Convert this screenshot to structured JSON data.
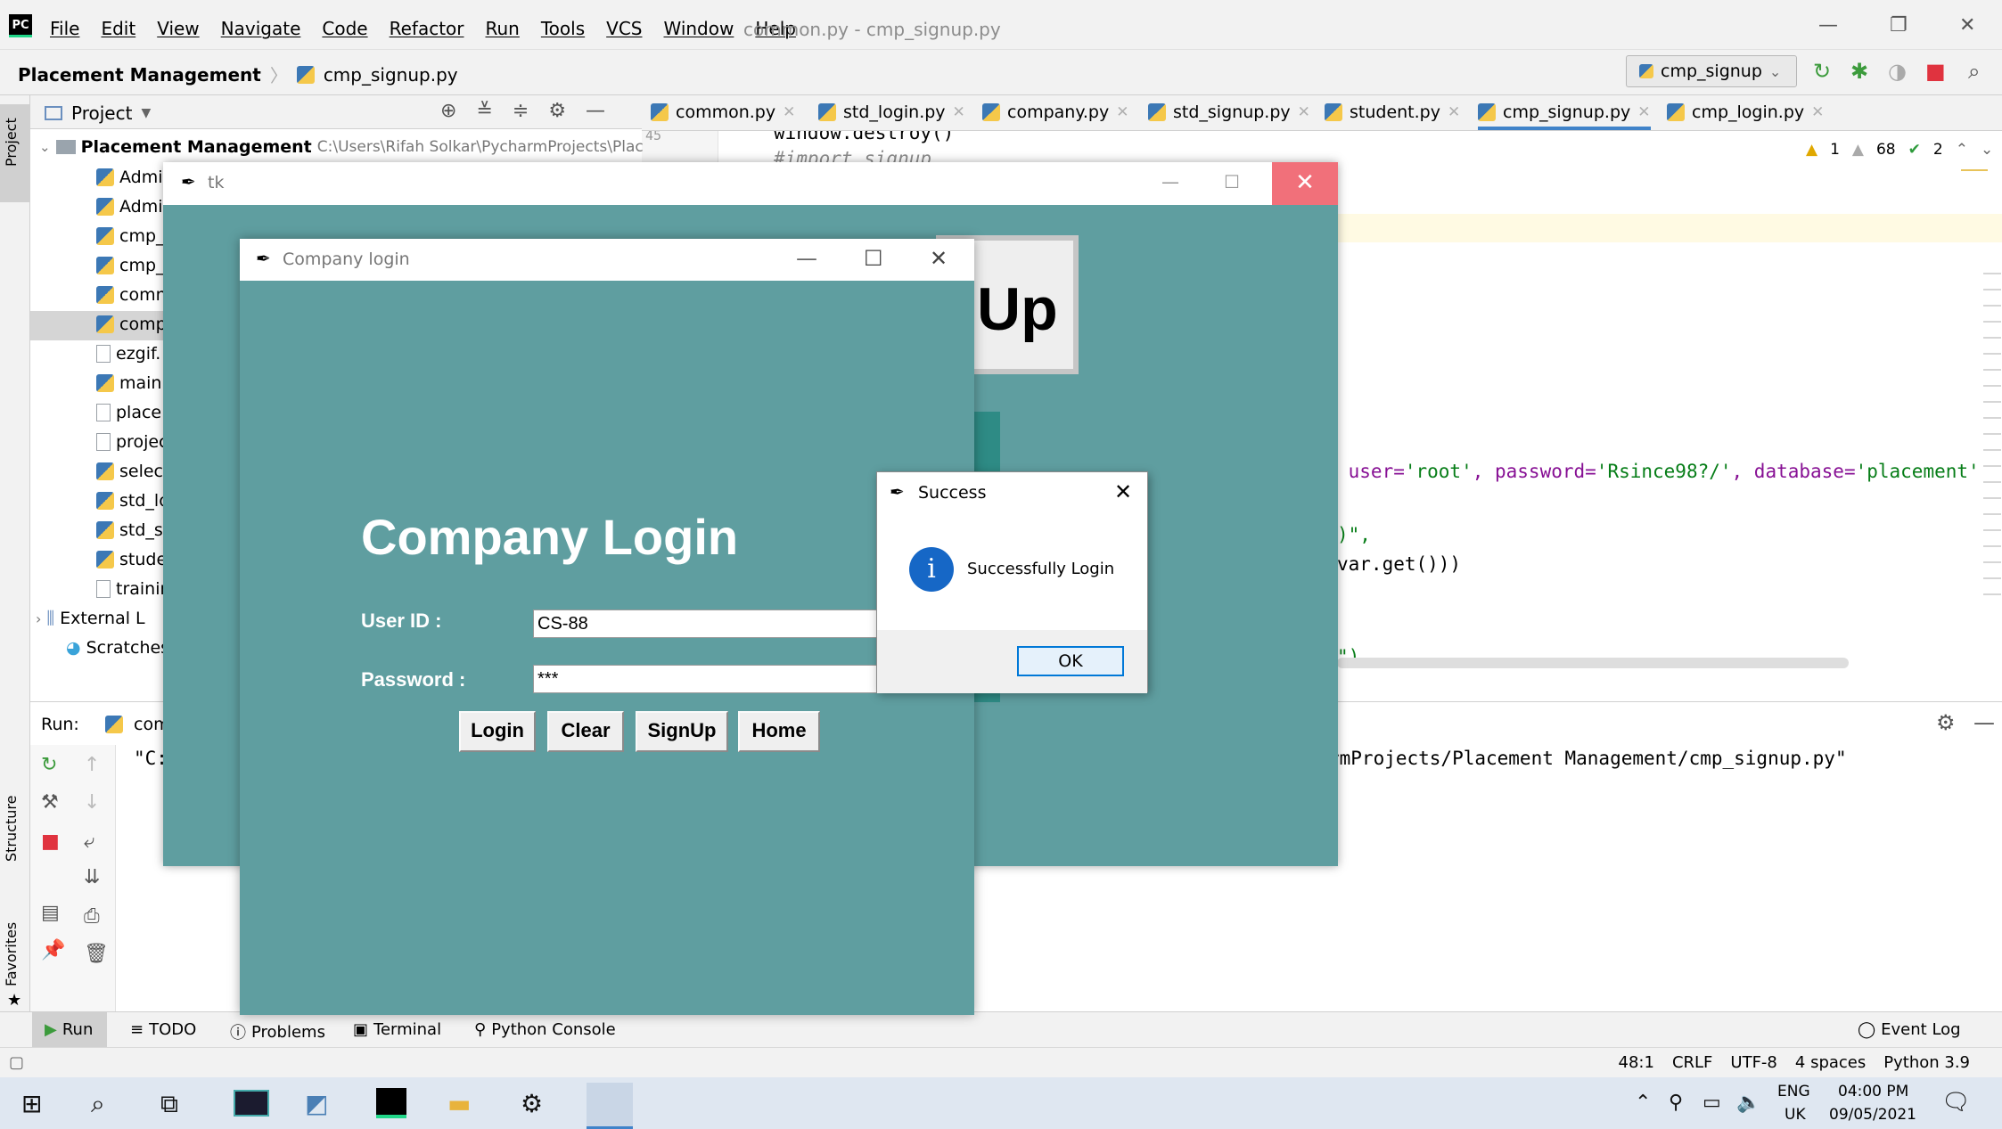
{
  "menubar": {
    "logo": "PC",
    "items": [
      "File",
      "Edit",
      "View",
      "Navigate",
      "Code",
      "Refactor",
      "Run",
      "Tools",
      "VCS",
      "Window",
      "Help"
    ],
    "window_title": "common.py - cmp_signup.py"
  },
  "navbar": {
    "project": "Placement Management",
    "file": "cmp_signup.py",
    "run_config": "cmp_signup"
  },
  "project_panel": {
    "title": "Project",
    "root": "Placement Management",
    "root_path": "C:\\Users\\Rifah Solkar\\PycharmProjects\\Plac",
    "files": [
      "Admi",
      "Admi",
      "cmp_",
      "cmp_",
      "comn",
      "comp",
      "ezgif.",
      "main.",
      "place.",
      "projec",
      "select",
      "std_lo",
      "std_si",
      "stude",
      "trainin"
    ],
    "external": "External L",
    "scratches": "Scratches"
  },
  "editor": {
    "tabs": [
      "common.py",
      "std_login.py",
      "company.py",
      "std_signup.py",
      "student.py",
      "cmp_signup.py",
      "cmp_login.py"
    ],
    "active_tab": "cmp_signup.py",
    "line_no": "45",
    "code_top": "window.destroy()",
    "code_top2": "#import signup",
    "code_conn": " user=",
    "code_root": "'root'",
    "code_pw": ", password=",
    "code_pwv": "'Rsince98?/'",
    "code_db": ", database=",
    "code_dbv": "'placement'",
    "code_l2": ")\",",
    "code_l3": "var.get()))",
    "code_l4": "\")",
    "inspections": {
      "warn": "1",
      "weak": "68",
      "ok": "2"
    }
  },
  "run": {
    "label": "Run:",
    "config": "com",
    "output_prefix": "\"C:",
    "output_suffix": "rmProjects/Placement Management/cmp_signup.py\""
  },
  "side_tabs": {
    "project": "Project",
    "structure": "Structure",
    "favorites": "Favorites"
  },
  "bottom_tabs": [
    "Run",
    "TODO",
    "Problems",
    "Terminal",
    "Python Console"
  ],
  "event_log": "Event Log",
  "status": {
    "position": "48:1",
    "line_sep": "CRLF",
    "encoding": "UTF-8",
    "indent": "4 spaces",
    "interpreter": "Python 3.9"
  },
  "tk_main": {
    "title": "tk",
    "button_fragment": "Up"
  },
  "company_login": {
    "title": "Company login",
    "heading": "Company Login",
    "user_label": "User ID :",
    "user_value": "CS-88",
    "password_label": "Password :",
    "password_value": "***",
    "buttons": [
      "Login",
      "Clear",
      "SignUp",
      "Home"
    ]
  },
  "dialog": {
    "title": "Success",
    "message": "Successfully Login",
    "ok": "OK"
  },
  "taskbar": {
    "lang": "ENG",
    "region": "UK",
    "time": "04:00 PM",
    "date": "09/05/2021"
  },
  "colors": {
    "teal": "#5f9ea0",
    "accent": "#4083c9",
    "close_red": "#f1707a",
    "info_blue": "#1667c6"
  }
}
